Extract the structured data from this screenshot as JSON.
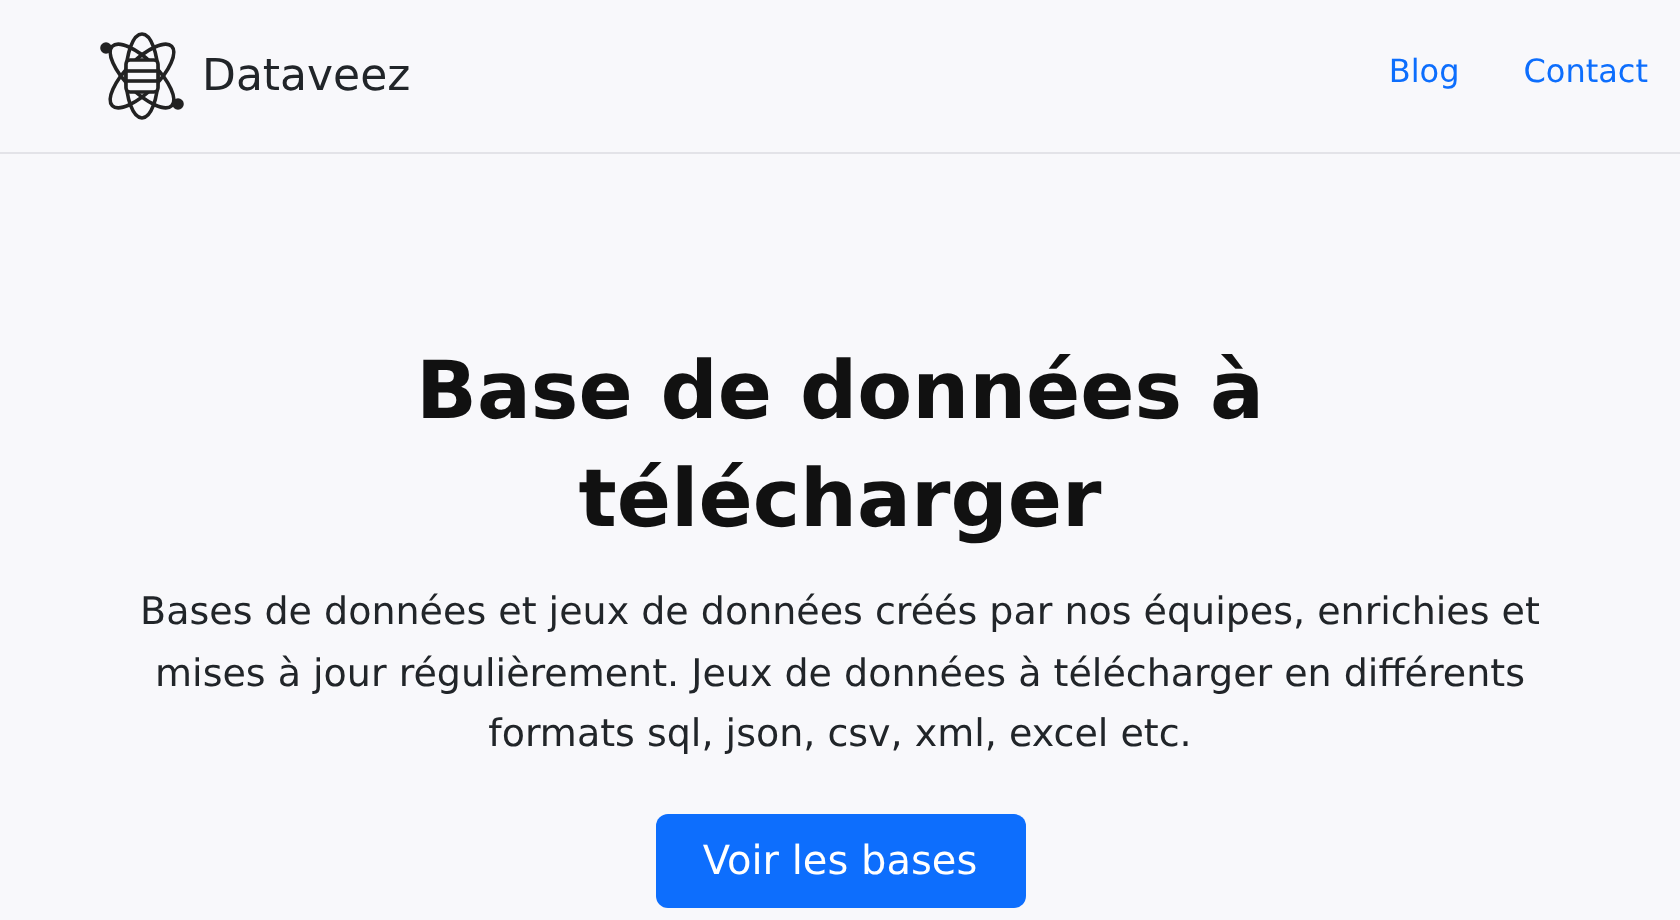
{
  "header": {
    "brand": "Dataveez",
    "nav": [
      "Blog",
      "Contact"
    ]
  },
  "hero": {
    "title": "Base de données à télécharger",
    "text": "Bases de données et jeux de données créés par nos équipes, enrichies et mises à jour régulièrement. Jeux de données à télécharger en différents formats sql, json, csv, xml, excel etc.",
    "button": "Voir les bases"
  }
}
